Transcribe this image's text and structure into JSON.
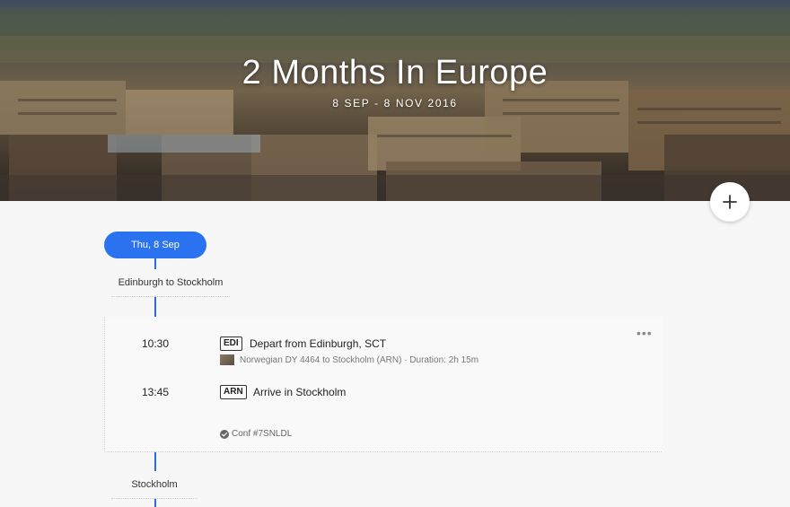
{
  "trip": {
    "title": "2 Months In Europe",
    "dates": "8 SEP - 8 NOV 2016"
  },
  "timeline": {
    "day_label": "Thu, 8 Sep",
    "segment_label": "Edinburgh to Stockholm",
    "next_section_label": "Stockholm"
  },
  "flight": {
    "depart": {
      "time": "10:30",
      "code": "EDI",
      "title": "Depart from Edinburgh, SCT",
      "details": "Norwegian DY 4464 to Stockholm (ARN) · Duration: 2h 15m"
    },
    "arrive": {
      "time": "13:45",
      "code": "ARN",
      "title": "Arrive in Stockholm"
    },
    "confirmation": "Conf #7SNLDL",
    "more_label": "•••"
  },
  "icons": {
    "add": "plus-icon",
    "check": "check-circle-icon",
    "more": "more-horizontal-icon"
  },
  "colors": {
    "accent": "#2a72f0",
    "timeline": "#2a6be6"
  }
}
